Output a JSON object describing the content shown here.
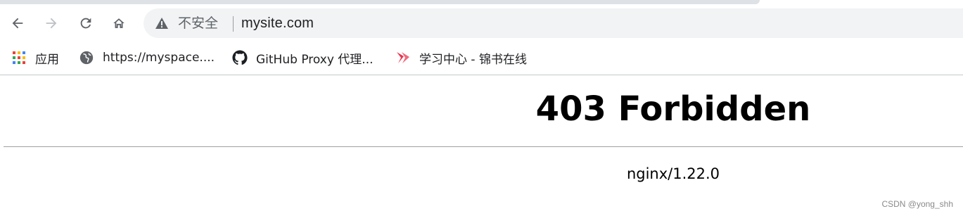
{
  "toolbar": {
    "security_label": "不安全",
    "url": "mysite.com"
  },
  "bookmarks": [
    {
      "label": "应用",
      "icon": "apps-grid-icon"
    },
    {
      "label": "https://myspace....",
      "icon": "globe-icon"
    },
    {
      "label": "GitHub Proxy 代理...",
      "icon": "github-icon"
    },
    {
      "label": "学习中心 - 锦书在线",
      "icon": "red-logo-icon"
    }
  ],
  "page": {
    "heading": "403 Forbidden",
    "server": "nginx/1.22.0"
  },
  "watermark": "CSDN @yong_shh",
  "colors": {
    "omnibox_bg": "#f1f3f4",
    "tabstrip_bg": "#dee1e6",
    "icon_gray": "#5f6368",
    "disabled_gray": "#bdc1c6"
  }
}
